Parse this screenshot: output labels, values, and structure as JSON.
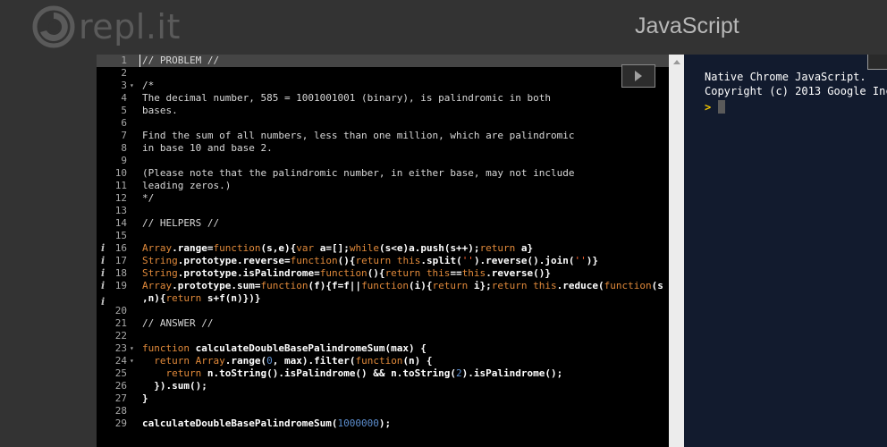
{
  "header": {
    "logo_text": "repl.it",
    "language": "JavaScript"
  },
  "icons": {
    "logo": "replit-swirl-logo-icon",
    "run": "play-triangle-icon",
    "scroll_up": "scroll-up-arrow-icon",
    "annotation": "info-icon",
    "prompt": "prompt-chevron-icon"
  },
  "editor": {
    "annotated_lines": [
      16,
      17,
      18,
      19,
      20
    ],
    "highlighted_line": 1,
    "lines": [
      {
        "n": "1",
        "fold": "",
        "tokens": [
          [
            "c",
            "// PROBLEM //"
          ]
        ]
      },
      {
        "n": "2",
        "fold": "",
        "tokens": []
      },
      {
        "n": "3",
        "fold": "▾",
        "tokens": [
          [
            "c",
            "/*"
          ]
        ]
      },
      {
        "n": "4",
        "fold": "",
        "tokens": [
          [
            "c",
            "The decimal number, 585 = 1001001001 (binary), is palindromic in both"
          ]
        ]
      },
      {
        "n": "5",
        "fold": "",
        "tokens": [
          [
            "c",
            "bases."
          ]
        ]
      },
      {
        "n": "6",
        "fold": "",
        "tokens": []
      },
      {
        "n": "7",
        "fold": "",
        "tokens": [
          [
            "c",
            "Find the sum of all numbers, less than one million, which are palindromic"
          ]
        ]
      },
      {
        "n": "8",
        "fold": "",
        "tokens": [
          [
            "c",
            "in base 10 and base 2."
          ]
        ]
      },
      {
        "n": "9",
        "fold": "",
        "tokens": []
      },
      {
        "n": "10",
        "fold": "",
        "tokens": [
          [
            "c",
            "(Please note that the palindromic number, in either base, may not include"
          ]
        ]
      },
      {
        "n": "11",
        "fold": "",
        "tokens": [
          [
            "c",
            "leading zeros.)"
          ]
        ]
      },
      {
        "n": "12",
        "fold": "",
        "tokens": [
          [
            "c",
            "*/"
          ]
        ]
      },
      {
        "n": "13",
        "fold": "",
        "tokens": []
      },
      {
        "n": "14",
        "fold": "",
        "tokens": [
          [
            "c",
            "// HELPERS //"
          ]
        ]
      },
      {
        "n": "15",
        "fold": "",
        "tokens": []
      },
      {
        "n": "16",
        "fold": "",
        "tokens": [
          [
            "k",
            "Array"
          ],
          [
            "i",
            ".range="
          ],
          [
            "k",
            "function"
          ],
          [
            "i",
            "(s,e){"
          ],
          [
            "k",
            "var"
          ],
          [
            "i",
            " a=[];"
          ],
          [
            "k",
            "while"
          ],
          [
            "i",
            "(s<e)a.push(s++);"
          ],
          [
            "k",
            "return"
          ],
          [
            "i",
            " a}"
          ]
        ]
      },
      {
        "n": "17",
        "fold": "",
        "tokens": [
          [
            "k",
            "String"
          ],
          [
            "i",
            ".prototype.reverse="
          ],
          [
            "k",
            "function"
          ],
          [
            "i",
            "(){"
          ],
          [
            "k",
            "return"
          ],
          [
            "i",
            " "
          ],
          [
            "k",
            "this"
          ],
          [
            "i",
            ".split("
          ],
          [
            "s",
            "''"
          ],
          [
            "i",
            ").reverse().join("
          ],
          [
            "s",
            "''"
          ],
          [
            "i",
            ")}"
          ]
        ]
      },
      {
        "n": "18",
        "fold": "",
        "tokens": [
          [
            "k",
            "String"
          ],
          [
            "i",
            ".prototype.isPalindrome="
          ],
          [
            "k",
            "function"
          ],
          [
            "i",
            "(){"
          ],
          [
            "k",
            "return"
          ],
          [
            "i",
            " "
          ],
          [
            "k",
            "this"
          ],
          [
            "i",
            "=="
          ],
          [
            "k",
            "this"
          ],
          [
            "i",
            ".reverse()}"
          ]
        ]
      },
      {
        "n": "19",
        "fold": "",
        "tokens": [
          [
            "k",
            "Array"
          ],
          [
            "i",
            ".prototype.sum="
          ],
          [
            "k",
            "function"
          ],
          [
            "i",
            "(f){f=f||"
          ],
          [
            "k",
            "function"
          ],
          [
            "i",
            "(i){"
          ],
          [
            "k",
            "return"
          ],
          [
            "i",
            " i};"
          ],
          [
            "k",
            "return"
          ],
          [
            "i",
            " "
          ],
          [
            "k",
            "this"
          ],
          [
            "i",
            ".reduce("
          ],
          [
            "k",
            "function"
          ],
          [
            "i",
            "(s"
          ]
        ]
      },
      {
        "n": "",
        "fold": "",
        "tokens": [
          [
            "i",
            ",n){"
          ],
          [
            "k",
            "return"
          ],
          [
            "i",
            " s+f(n)})}"
          ]
        ]
      },
      {
        "n": "20",
        "fold": "",
        "tokens": []
      },
      {
        "n": "21",
        "fold": "",
        "tokens": [
          [
            "c",
            "// ANSWER //"
          ]
        ]
      },
      {
        "n": "22",
        "fold": "",
        "tokens": []
      },
      {
        "n": "23",
        "fold": "▾",
        "tokens": [
          [
            "k",
            "function"
          ],
          [
            "i",
            " calculateDoubleBasePalindromeSum(max) {"
          ]
        ]
      },
      {
        "n": "24",
        "fold": "▾",
        "tokens": [
          [
            "i",
            "  "
          ],
          [
            "k",
            "return"
          ],
          [
            "i",
            " "
          ],
          [
            "k",
            "Array"
          ],
          [
            "i",
            ".range("
          ],
          [
            "n",
            "0"
          ],
          [
            "i",
            ", max).filter("
          ],
          [
            "k",
            "function"
          ],
          [
            "i",
            "(n) {"
          ]
        ]
      },
      {
        "n": "25",
        "fold": "",
        "tokens": [
          [
            "i",
            "    "
          ],
          [
            "k",
            "return"
          ],
          [
            "i",
            " n.toString().isPalindrome() && n.toString("
          ],
          [
            "n",
            "2"
          ],
          [
            "i",
            ").isPalindrome();"
          ]
        ]
      },
      {
        "n": "26",
        "fold": "",
        "tokens": [
          [
            "i",
            "  }).sum();"
          ]
        ]
      },
      {
        "n": "27",
        "fold": "",
        "tokens": [
          [
            "i",
            "}"
          ]
        ]
      },
      {
        "n": "28",
        "fold": "",
        "tokens": []
      },
      {
        "n": "29",
        "fold": "",
        "tokens": [
          [
            "i",
            "calculateDoubleBasePalindromeSum("
          ],
          [
            "n",
            "1000000"
          ],
          [
            "i",
            ");"
          ]
        ]
      }
    ]
  },
  "console": {
    "lines": [
      "Native Chrome JavaScript.",
      "Copyright (c) 2013 Google Inc"
    ],
    "prompt": ">"
  },
  "colors": {
    "background": "#333333",
    "editor_bg": "#000000",
    "console_bg": "#121b2e",
    "keyword": "#e0893a",
    "string": "#ff6633",
    "number": "#5d8fd0",
    "prompt": "#f3c600"
  }
}
